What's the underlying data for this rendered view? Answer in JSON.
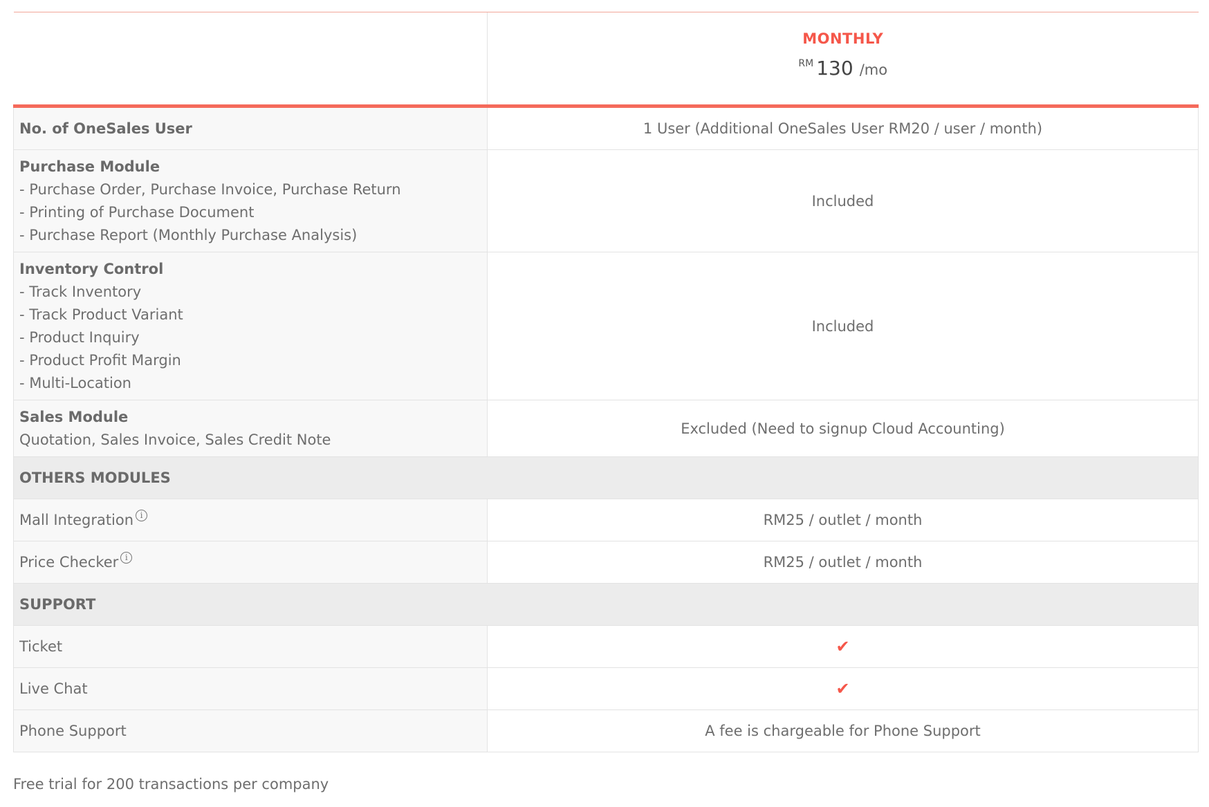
{
  "header": {
    "plan_name": "MONTHLY",
    "currency": "RM",
    "price": "130",
    "period": "/mo"
  },
  "rows": {
    "users": {
      "label": "No. of OneSales User",
      "value": "1 User (Additional OneSales User RM20 / user / month)"
    },
    "purchase": {
      "title": "Purchase Module",
      "items": [
        "- Purchase Order, Purchase Invoice, Purchase Return",
        "- Printing of Purchase Document",
        "- Purchase Report (Monthly Purchase Analysis)"
      ],
      "value": "Included"
    },
    "inventory": {
      "title": "Inventory Control",
      "items": [
        "- Track Inventory",
        "- Track Product Variant",
        "- Product Inquiry",
        "- Product Profit Margin",
        "- Multi-Location"
      ],
      "value": "Included"
    },
    "sales": {
      "title": "Sales Module",
      "subtitle": "Quotation, Sales Invoice, Sales Credit Note",
      "value": "Excluded (Need to signup Cloud Accounting)"
    }
  },
  "others": {
    "heading": "OTHERS MODULES",
    "mall": {
      "label": "Mall Integration",
      "value": "RM25 / outlet / month"
    },
    "price_checker": {
      "label": "Price Checker",
      "value": "RM25 / outlet / month"
    }
  },
  "support": {
    "heading": "SUPPORT",
    "ticket": {
      "label": "Ticket",
      "value": "✔"
    },
    "live_chat": {
      "label": "Live Chat",
      "value": "✔"
    },
    "phone": {
      "label": "Phone Support",
      "value": "A fee is chargeable for Phone Support"
    }
  },
  "info_glyph": "i",
  "footer_note": "Free trial for 200 transactions per company",
  "colors": {
    "accent": "#f5574a",
    "section_bg": "#ececec",
    "label_bg": "#f8f8f8"
  }
}
